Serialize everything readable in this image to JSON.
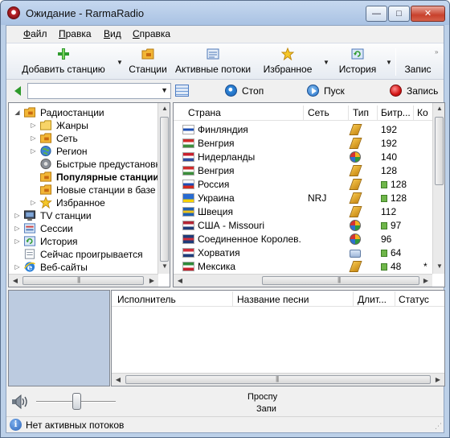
{
  "window": {
    "title": "Ожидание - RarmaRadio",
    "controls": {
      "minimize": "—",
      "maximize": "□",
      "close": "✕"
    }
  },
  "menu": [
    "Файл",
    "Правка",
    "Вид",
    "Справка"
  ],
  "toolbar": {
    "buttons": [
      {
        "label": "Добавить станцию",
        "icon": "add-station-icon",
        "dropdown": true
      },
      {
        "label": "Станции",
        "icon": "folder-radio-icon",
        "dropdown": false
      },
      {
        "label": "Активные потоки",
        "icon": "streams-icon",
        "dropdown": false
      },
      {
        "label": "Избранное",
        "icon": "star-icon",
        "dropdown": true
      },
      {
        "label": "История",
        "icon": "history-icon",
        "dropdown": true
      },
      {
        "label": "Запис",
        "icon": "record-icon",
        "dropdown": false
      }
    ]
  },
  "address_bar": {
    "value": "",
    "stop_label": "Стоп",
    "play_label": "Пуск",
    "record_label": "Запись"
  },
  "tree": {
    "items": [
      {
        "label": "Радиостанции",
        "level": 0,
        "expander": "◢",
        "icon": "folder-radio-icon",
        "bold": false
      },
      {
        "label": "Жанры",
        "level": 1,
        "expander": "▷",
        "icon": "folder-icon",
        "bold": false
      },
      {
        "label": "Сеть",
        "level": 1,
        "expander": "▷",
        "icon": "folder-radio-icon",
        "bold": false
      },
      {
        "label": "Регион",
        "level": 1,
        "expander": "▷",
        "icon": "globe-icon",
        "bold": false
      },
      {
        "label": "Быстрые предустановк",
        "level": 1,
        "expander": "",
        "icon": "preset-icon",
        "bold": false
      },
      {
        "label": "Популярные станции",
        "level": 1,
        "expander": "",
        "icon": "folder-radio-icon",
        "bold": true
      },
      {
        "label": "Новые станции в базе",
        "level": 1,
        "expander": "",
        "icon": "folder-radio-icon",
        "bold": false
      },
      {
        "label": "Избранное",
        "level": 1,
        "expander": "▷",
        "icon": "star-icon",
        "bold": false
      },
      {
        "label": "TV станции",
        "level": 0,
        "expander": "▷",
        "icon": "tv-icon",
        "bold": false
      },
      {
        "label": "Сессии",
        "level": 0,
        "expander": "▷",
        "icon": "sessions-icon",
        "bold": false
      },
      {
        "label": "История",
        "level": 0,
        "expander": "▷",
        "icon": "history-icon",
        "bold": false
      },
      {
        "label": "Сейчас проигрывается",
        "level": 0,
        "expander": "",
        "icon": "now-playing-icon",
        "bold": false
      },
      {
        "label": "Веб-сайты",
        "level": 0,
        "expander": "▷",
        "icon": "ie-icon",
        "bold": false
      }
    ]
  },
  "stations": {
    "columns": [
      "Страна",
      "Сеть",
      "Тип",
      "Битр...",
      "Ко"
    ],
    "rows": [
      {
        "country": "Финляндия",
        "network": "",
        "type": "radio",
        "bitrate": "192",
        "extra": "",
        "flag": [
          "#ffffff",
          "#1e4fb4",
          "#ffffff"
        ],
        "br_icon": false
      },
      {
        "country": "Венгрия",
        "network": "",
        "type": "radio",
        "bitrate": "192",
        "extra": "",
        "flag": [
          "#d02b2b",
          "#ffffff",
          "#3c8d3c"
        ],
        "br_icon": false
      },
      {
        "country": "Нидерланды",
        "network": "",
        "type": "media",
        "bitrate": "140",
        "extra": "",
        "flag": [
          "#c8202e",
          "#ffffff",
          "#2d4da0"
        ],
        "br_icon": false
      },
      {
        "country": "Венгрия",
        "network": "",
        "type": "radio",
        "bitrate": "128",
        "extra": "",
        "flag": [
          "#d02b2b",
          "#ffffff",
          "#3c8d3c"
        ],
        "br_icon": false
      },
      {
        "country": "Россия",
        "network": "",
        "type": "radio",
        "bitrate": "128",
        "extra": "",
        "flag": [
          "#ffffff",
          "#1e4fb4",
          "#d52b1e"
        ],
        "br_icon": true
      },
      {
        "country": "Украина",
        "network": "NRJ",
        "type": "radio",
        "bitrate": "128",
        "extra": "",
        "flag": [
          "#2a6bd0",
          "#2a6bd0",
          "#f5d100"
        ],
        "br_icon": true
      },
      {
        "country": "Швеция",
        "network": "",
        "type": "radio",
        "bitrate": "112",
        "extra": "",
        "flag": [
          "#1f5fb3",
          "#f0c419",
          "#1f5fb3"
        ],
        "br_icon": false
      },
      {
        "country": "США - Missouri",
        "network": "",
        "type": "media",
        "bitrate": "97",
        "extra": "",
        "flag": [
          "#b32535",
          "#ffffff",
          "#1f3c7a"
        ],
        "br_icon": true
      },
      {
        "country": "Соединенное Королев...",
        "network": "",
        "type": "media",
        "bitrate": "96",
        "extra": "",
        "flag": [
          "#1f3c7a",
          "#d22f3c",
          "#1f3c7a"
        ],
        "br_icon": false
      },
      {
        "country": "Хорватия",
        "network": "",
        "type": "tv",
        "bitrate": "64",
        "extra": "",
        "flag": [
          "#d22f3c",
          "#ffffff",
          "#1f3c7a"
        ],
        "br_icon": true
      },
      {
        "country": "Мексика",
        "network": "",
        "type": "radio",
        "bitrate": "48",
        "extra": "*",
        "flag": [
          "#2f8a3a",
          "#ffffff",
          "#c8202e"
        ],
        "br_icon": true
      }
    ]
  },
  "tracks": {
    "columns": [
      "Исполнитель",
      "Название песни",
      "Длит...",
      "Статус"
    ]
  },
  "volume": {
    "level": 0.5,
    "line1": "Проспу",
    "line2": "Запи"
  },
  "status": {
    "text": "Нет активных потоков"
  }
}
